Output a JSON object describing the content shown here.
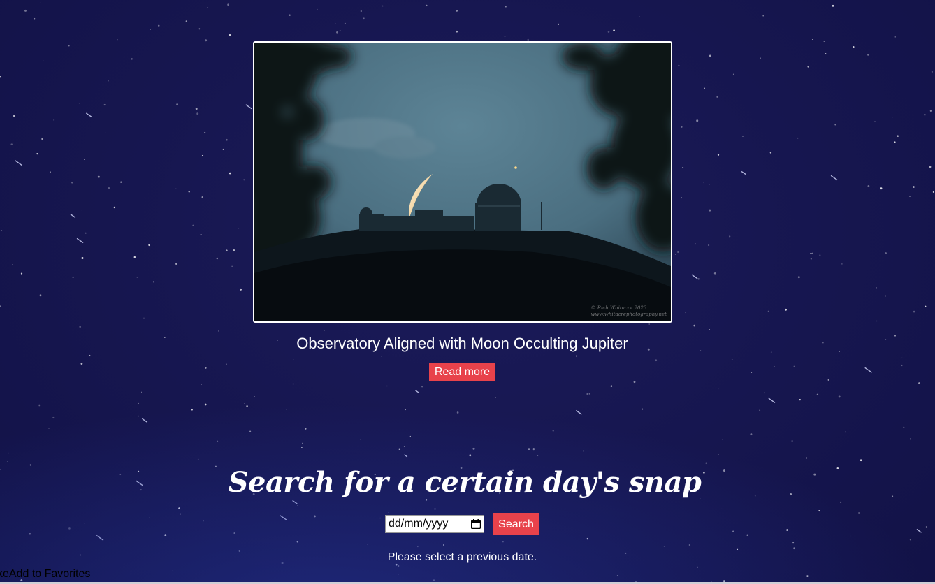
{
  "apod": {
    "title": "Observatory Aligned with Moon Occulting Jupiter",
    "read_more_label": "Read more",
    "image_alt": "Crescent moon and Jupiter above an observatory dome framed by dark foliage",
    "credit_line1": "© Rich Whitacre 2023",
    "credit_line2": "www.whitacrephotography.net"
  },
  "search": {
    "heading": "Search for a certain day's snap",
    "date_placeholder": "dd/mm/yyyy",
    "button_label": "Search",
    "hint": "Please select a previous date."
  },
  "footer": {
    "favorites_label": "keAdd to Favorites"
  },
  "colors": {
    "accent": "#e8424b",
    "background": "#16164f",
    "text": "#ffffff"
  },
  "icons": {
    "date_picker": "calendar-icon"
  }
}
